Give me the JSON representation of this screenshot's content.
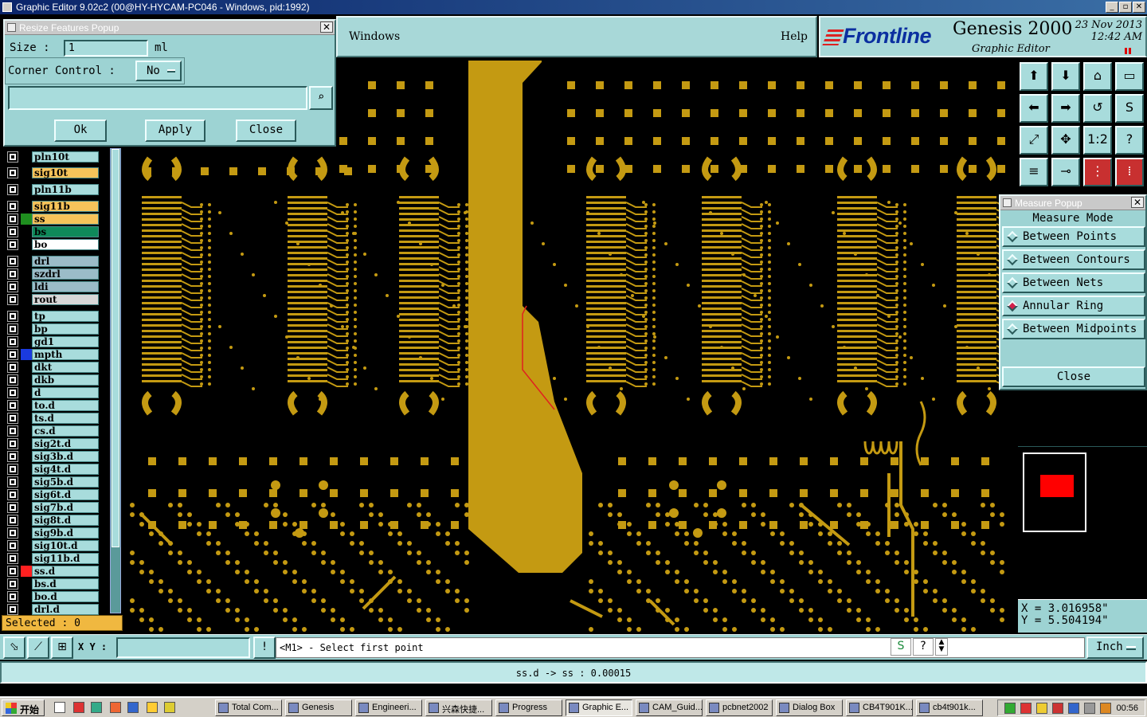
{
  "window": {
    "title": "Graphic Editor 9.02c2 (00@HY-HYCAM-PC046 - Windows, pid:1992)"
  },
  "menu": {
    "windows": "Windows",
    "help": "Help"
  },
  "brand": {
    "logo": "Frontline",
    "product": "Genesis 2000",
    "subtitle": "Graphic Editor",
    "date": "23 Nov 2013",
    "time": "12:42 AM"
  },
  "resize_popup": {
    "title": "Resize Features Popup",
    "size_label": "Size :",
    "size_value": "1",
    "size_unit": "ml",
    "corner_label": "Corner Control :",
    "corner_value": "No",
    "ok": "Ok",
    "apply": "Apply",
    "close": "Close"
  },
  "layers": [
    {
      "name": "pln10t",
      "color": "#a8dcdc",
      "swatch": "#000000"
    },
    {
      "name": "sig10t",
      "color": "#f6c35a",
      "swatch": "#000000"
    },
    {
      "name": "pln11b",
      "color": "#a8dcdc",
      "swatch": "#000000"
    },
    {
      "name": "sig11b",
      "color": "#f6c35a",
      "swatch": "#000000"
    },
    {
      "name": "ss",
      "color": "#f6c35a",
      "swatch": "#1f8f1f"
    },
    {
      "name": "bs",
      "color": "#0f8a5a",
      "swatch": "#000000"
    },
    {
      "name": "bo",
      "color": "#ffffff",
      "swatch": "#000000"
    },
    {
      "name": "drl",
      "color": "#9bbcc8",
      "swatch": "#000000"
    },
    {
      "name": "szdrl",
      "color": "#9bbcc8",
      "swatch": "#000000"
    },
    {
      "name": "ldi",
      "color": "#9bbcc8",
      "swatch": "#000000"
    },
    {
      "name": "rout",
      "color": "#d8d8d8",
      "swatch": "#000000"
    },
    {
      "name": "tp",
      "color": "#a8dcdc",
      "swatch": "#000000"
    },
    {
      "name": "bp",
      "color": "#a8dcdc",
      "swatch": "#000000"
    },
    {
      "name": "gd1",
      "color": "#a8dcdc",
      "swatch": "#000000"
    },
    {
      "name": "mpth",
      "color": "#a8dcdc",
      "swatch": "#1a3ae0"
    },
    {
      "name": "dkt",
      "color": "#a8dcdc",
      "swatch": "#000000"
    },
    {
      "name": "dkb",
      "color": "#a8dcdc",
      "swatch": "#000000"
    },
    {
      "name": "d",
      "color": "#a8dcdc",
      "swatch": "#000000"
    },
    {
      "name": "to.d",
      "color": "#a8dcdc",
      "swatch": "#000000"
    },
    {
      "name": "ts.d",
      "color": "#a8dcdc",
      "swatch": "#000000"
    },
    {
      "name": "cs.d",
      "color": "#a8dcdc",
      "swatch": "#000000"
    },
    {
      "name": "sig2t.d",
      "color": "#a8dcdc",
      "swatch": "#000000"
    },
    {
      "name": "sig3b.d",
      "color": "#a8dcdc",
      "swatch": "#000000"
    },
    {
      "name": "sig4t.d",
      "color": "#a8dcdc",
      "swatch": "#000000"
    },
    {
      "name": "sig5b.d",
      "color": "#a8dcdc",
      "swatch": "#000000"
    },
    {
      "name": "sig6t.d",
      "color": "#a8dcdc",
      "swatch": "#000000"
    },
    {
      "name": "sig7b.d",
      "color": "#a8dcdc",
      "swatch": "#000000"
    },
    {
      "name": "sig8t.d",
      "color": "#a8dcdc",
      "swatch": "#000000"
    },
    {
      "name": "sig9b.d",
      "color": "#a8dcdc",
      "swatch": "#000000"
    },
    {
      "name": "sig10t.d",
      "color": "#a8dcdc",
      "swatch": "#000000"
    },
    {
      "name": "sig11b.d",
      "color": "#a8dcdc",
      "swatch": "#000000"
    },
    {
      "name": "ss.d",
      "color": "#a8dcdc",
      "swatch": "#ff2020"
    },
    {
      "name": "bs.d",
      "color": "#a8dcdc",
      "swatch": "#000000"
    },
    {
      "name": "bo.d",
      "color": "#a8dcdc",
      "swatch": "#000000"
    },
    {
      "name": "drl.d",
      "color": "#a8dcdc",
      "swatch": "#000000"
    }
  ],
  "selected": "Selected : 0",
  "measure_popup": {
    "title": "Measure Popup",
    "header": "Measure Mode",
    "options": [
      {
        "label": "Between Points",
        "active": false
      },
      {
        "label": "Between Contours",
        "active": false
      },
      {
        "label": "Between Nets",
        "active": false
      },
      {
        "label": "Annular Ring",
        "active": true
      },
      {
        "label": "Between Midpoints",
        "active": false
      }
    ],
    "close": "Close"
  },
  "tools": [
    {
      "icon": "pan-up-icon"
    },
    {
      "icon": "pan-down-icon"
    },
    {
      "icon": "home-icon"
    },
    {
      "icon": "window-icon"
    },
    {
      "icon": "pan-left-icon"
    },
    {
      "icon": "pan-right-icon"
    },
    {
      "icon": "undo-zoom-icon"
    },
    {
      "icon": "snap-icon"
    },
    {
      "icon": "fit-icon"
    },
    {
      "icon": "center-icon"
    },
    {
      "icon": "scale-icon",
      "text": "1:2"
    },
    {
      "icon": "help-icon",
      "text": "?"
    },
    {
      "icon": "pad-tool-icon"
    },
    {
      "icon": "probe-icon"
    },
    {
      "icon": "net-icon",
      "red": true
    },
    {
      "icon": "net-compare-icon",
      "red": true
    }
  ],
  "coordinates": {
    "x": "X = 3.016958\"",
    "y": "Y = 5.504194\""
  },
  "command": {
    "xy_label": "X Y :",
    "prompt": "<M1> - Select first point",
    "unit": "Inch"
  },
  "status": "ss.d -> ss : 0.00015",
  "taskbar": {
    "start": "开始",
    "tasks": [
      "Total Com...",
      "Genesis",
      "Engineeri...",
      "兴森快捷...",
      "Progress",
      "Graphic E...",
      "CAM_Guid...",
      "pcbnet2002",
      "Dialog Box",
      "CB4T901K...",
      "cb4t901k..."
    ],
    "active_task": "Graphic E...",
    "clock": "00:56"
  },
  "colors": {
    "copper": "#c49a12",
    "panel": "#9dd3d3",
    "background": "#000000"
  }
}
